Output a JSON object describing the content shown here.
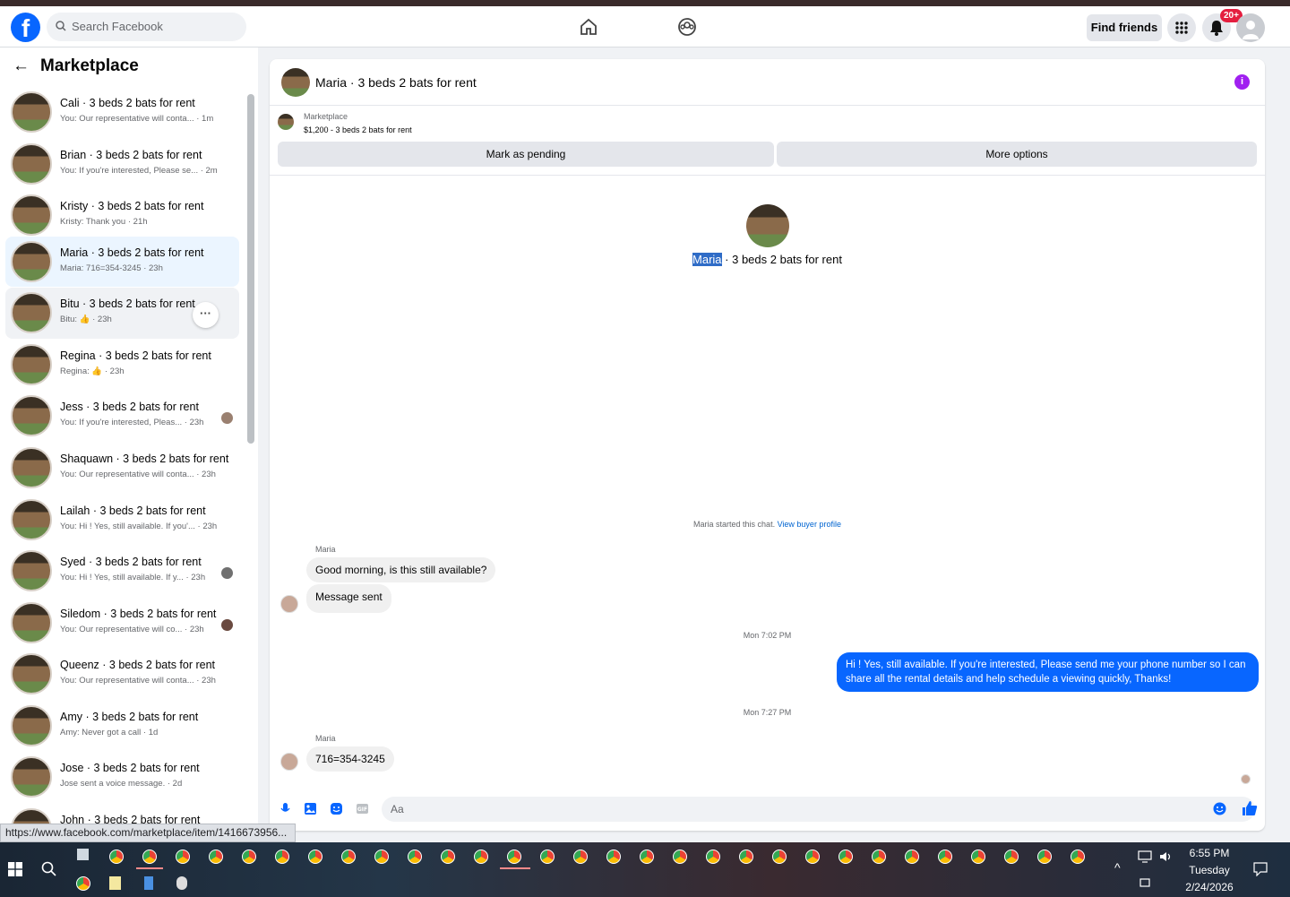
{
  "header": {
    "search_placeholder": "Search Facebook",
    "find_friends": "Find friends",
    "notif_badge": "20+"
  },
  "sidebar": {
    "title": "Marketplace",
    "conversations": [
      {
        "name": "Cali · 3 beds 2 bats for rent",
        "sub": "You: Our representative will conta... · 1m"
      },
      {
        "name": "Brian · 3 beds 2 bats for rent",
        "sub": "You: If you're interested, Please se... · 2m"
      },
      {
        "name": "Kristy · 3 beds 2 bats for rent",
        "sub": "Kristy: Thank you · 21h"
      },
      {
        "name": "Maria · 3 beds 2 bats for rent",
        "sub": "Maria: 716=354-3245 · 23h"
      },
      {
        "name": "Bitu · 3 beds 2 bats for rent",
        "sub": "Bitu: 👍 · 23h"
      },
      {
        "name": "Regina · 3 beds 2 bats for rent",
        "sub": "Regina: 👍 · 23h"
      },
      {
        "name": "Jess · 3 beds 2 bats for rent",
        "sub": "You: If you're interested, Pleas... · 23h"
      },
      {
        "name": "Shaquawn · 3 beds 2 bats for rent",
        "sub": "You: Our representative will conta... · 23h"
      },
      {
        "name": "Lailah · 3 beds 2 bats for rent",
        "sub": "You: Hi ! Yes, still available. If you'... · 23h"
      },
      {
        "name": "Syed · 3 beds 2 bats for rent",
        "sub": "You: Hi ! Yes, still available. If y... · 23h"
      },
      {
        "name": "Siledom · 3 beds 2 bats for rent",
        "sub": "You: Our representative will co... · 23h"
      },
      {
        "name": "Queenz · 3 beds 2 bats for rent",
        "sub": "You: Our representative will conta... · 23h"
      },
      {
        "name": "Amy · 3 beds 2 bats for rent",
        "sub": "Amy: Never got a call · 1d"
      },
      {
        "name": "Jose · 3 beds 2 bats for rent",
        "sub": "Jose sent a voice message. · 2d"
      },
      {
        "name": "John · 3 beds 2 bats for rent",
        "sub": ""
      }
    ]
  },
  "chat": {
    "title": "Maria · 3 beds 2 bats for rent",
    "marketplace_label": "Marketplace",
    "listing": "$1,200 - 3 beds 2 bats for rent",
    "mark_pending": "Mark as pending",
    "more_options": "More options",
    "center_name": "Maria",
    "center_rest": " · 3 beds 2 bats for rent",
    "started": "Maria started this chat. ",
    "view_profile": "View buyer profile",
    "sender1": "Maria",
    "msg1": "Good morning, is this still available?",
    "msg2": "Message sent",
    "time1": "Mon 7:02 PM",
    "out_msg": "Hi ! Yes, still available. If you're interested, Please send me your phone number so I can share all the rental details and help schedule a viewing quickly, Thanks!",
    "time2": "Mon 7:27 PM",
    "sender2": "Maria",
    "msg3": "716=354-3245",
    "composer_placeholder": "Aa"
  },
  "status_url": "https://www.facebook.com/marketplace/item/1416673956...",
  "taskbar": {
    "time": "6:55 PM",
    "day": "Tuesday",
    "date": "2/24/2026"
  },
  "colors": {
    "accent": "#0866ff",
    "info": "#a020f0",
    "badge": "#e41e3f"
  }
}
